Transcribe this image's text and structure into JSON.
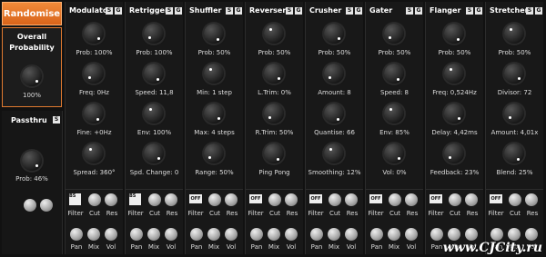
{
  "left": {
    "randomise_label": "Randomise",
    "overall_label_line1": "Overall",
    "overall_label_line2": "Probability",
    "overall_value": "100%",
    "passthru_label": "Passthru",
    "passthru_prob": "Prob: 46%"
  },
  "columns": [
    {
      "title": "Modulator",
      "knobs": [
        "Prob: 100%",
        "Freq: 0Hz",
        "Fine: +0Hz",
        "Spread: 360°"
      ],
      "has_bs": true
    },
    {
      "title": "Retrigger",
      "knobs": [
        "Prob: 100%",
        "Speed: 11,8",
        "Env: 100%",
        "Spd. Change: 0"
      ],
      "has_bs": true
    },
    {
      "title": "Shuffler",
      "knobs": [
        "Prob: 50%",
        "Min: 1 step",
        "Max: 4 steps",
        "Range: 50%"
      ],
      "has_bs": false
    },
    {
      "title": "Reverser",
      "knobs": [
        "Prob: 50%",
        "L.Trim: 0%",
        "R.Trim: 50%",
        "Ping Pong"
      ],
      "has_bs": false
    },
    {
      "title": "Crusher",
      "knobs": [
        "Prob: 50%",
        "Amount: 8",
        "Quantise: 66",
        "Smoothing: 12%"
      ],
      "has_bs": false
    },
    {
      "title": "Gater",
      "knobs": [
        "Prob: 50%",
        "Speed: 8",
        "Env: 85%",
        "Vol: 0%"
      ],
      "has_bs": false
    },
    {
      "title": "Flanger",
      "knobs": [
        "Prob: 50%",
        "Freq: 0,524Hz",
        "Delay: 4,42ms",
        "Feedback: 23%"
      ],
      "has_bs": false
    },
    {
      "title": "Stretcher",
      "knobs": [
        "Prob: 50%",
        "Divisor: 72",
        "Amount: 4,01x",
        "Blend: 25%"
      ],
      "has_bs": false
    }
  ],
  "sg_labels": {
    "s": "S",
    "g": "G"
  },
  "bottom_labels": {
    "filter": "Filter",
    "cut": "Cut",
    "res": "Res",
    "pan": "Pan",
    "mix": "Mix",
    "vol": "Vol",
    "off": "OFF",
    "bs": "BS"
  },
  "watermark": "www.CJCity.ru"
}
